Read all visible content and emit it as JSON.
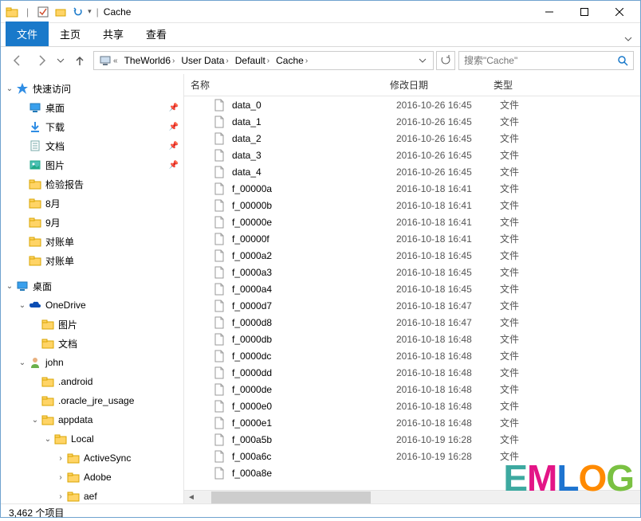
{
  "window": {
    "title": "Cache"
  },
  "ribbon": {
    "file": "文件",
    "tabs": [
      "主页",
      "共享",
      "查看"
    ]
  },
  "breadcrumb": {
    "items": [
      "TheWorld6",
      "User Data",
      "Default",
      "Cache"
    ]
  },
  "search": {
    "placeholder": "搜索\"Cache\""
  },
  "columns": {
    "name": "名称",
    "date": "修改日期",
    "type": "类型"
  },
  "nav": {
    "quick": {
      "label": "快速访问",
      "items": [
        {
          "label": "桌面",
          "icon": "desktop",
          "pinned": true
        },
        {
          "label": "下载",
          "icon": "download",
          "pinned": true
        },
        {
          "label": "文档",
          "icon": "doc",
          "pinned": true
        },
        {
          "label": "图片",
          "icon": "pic",
          "pinned": true
        },
        {
          "label": "检验报告",
          "icon": "folder",
          "pinned": false
        },
        {
          "label": "8月",
          "icon": "folder",
          "pinned": false
        },
        {
          "label": "9月",
          "icon": "folder",
          "pinned": false
        },
        {
          "label": "对账单",
          "icon": "folder",
          "pinned": false
        },
        {
          "label": "对账单",
          "icon": "folder",
          "pinned": false
        }
      ]
    },
    "desktop": {
      "label": "桌面"
    },
    "onedrive": {
      "label": "OneDrive",
      "items": [
        {
          "label": "图片"
        },
        {
          "label": "文档"
        }
      ]
    },
    "user": {
      "label": "john",
      "items": [
        {
          "label": ".android"
        },
        {
          "label": ".oracle_jre_usage"
        }
      ]
    },
    "appdata": {
      "label": "appdata",
      "items": [
        {
          "label": "Local",
          "expanded": true,
          "children": [
            {
              "label": "ActiveSync"
            },
            {
              "label": "Adobe"
            },
            {
              "label": "aef"
            }
          ]
        }
      ]
    }
  },
  "files": [
    {
      "name": "data_0",
      "date": "2016-10-26 16:45",
      "type": "文件"
    },
    {
      "name": "data_1",
      "date": "2016-10-26 16:45",
      "type": "文件"
    },
    {
      "name": "data_2",
      "date": "2016-10-26 16:45",
      "type": "文件"
    },
    {
      "name": "data_3",
      "date": "2016-10-26 16:45",
      "type": "文件"
    },
    {
      "name": "data_4",
      "date": "2016-10-26 16:45",
      "type": "文件"
    },
    {
      "name": "f_00000a",
      "date": "2016-10-18 16:41",
      "type": "文件"
    },
    {
      "name": "f_00000b",
      "date": "2016-10-18 16:41",
      "type": "文件"
    },
    {
      "name": "f_00000e",
      "date": "2016-10-18 16:41",
      "type": "文件"
    },
    {
      "name": "f_00000f",
      "date": "2016-10-18 16:41",
      "type": "文件"
    },
    {
      "name": "f_0000a2",
      "date": "2016-10-18 16:45",
      "type": "文件"
    },
    {
      "name": "f_0000a3",
      "date": "2016-10-18 16:45",
      "type": "文件"
    },
    {
      "name": "f_0000a4",
      "date": "2016-10-18 16:45",
      "type": "文件"
    },
    {
      "name": "f_0000d7",
      "date": "2016-10-18 16:47",
      "type": "文件"
    },
    {
      "name": "f_0000d8",
      "date": "2016-10-18 16:47",
      "type": "文件"
    },
    {
      "name": "f_0000db",
      "date": "2016-10-18 16:48",
      "type": "文件"
    },
    {
      "name": "f_0000dc",
      "date": "2016-10-18 16:48",
      "type": "文件"
    },
    {
      "name": "f_0000dd",
      "date": "2016-10-18 16:48",
      "type": "文件"
    },
    {
      "name": "f_0000de",
      "date": "2016-10-18 16:48",
      "type": "文件"
    },
    {
      "name": "f_0000e0",
      "date": "2016-10-18 16:48",
      "type": "文件"
    },
    {
      "name": "f_0000e1",
      "date": "2016-10-18 16:48",
      "type": "文件"
    },
    {
      "name": "f_000a5b",
      "date": "2016-10-19 16:28",
      "type": "文件"
    },
    {
      "name": "f_000a6c",
      "date": "2016-10-19 16:28",
      "type": "文件"
    },
    {
      "name": "f_000a8e",
      "date": "",
      "type": ""
    }
  ],
  "status": {
    "count": "3,462 个项目"
  },
  "watermark": "EMLOG"
}
